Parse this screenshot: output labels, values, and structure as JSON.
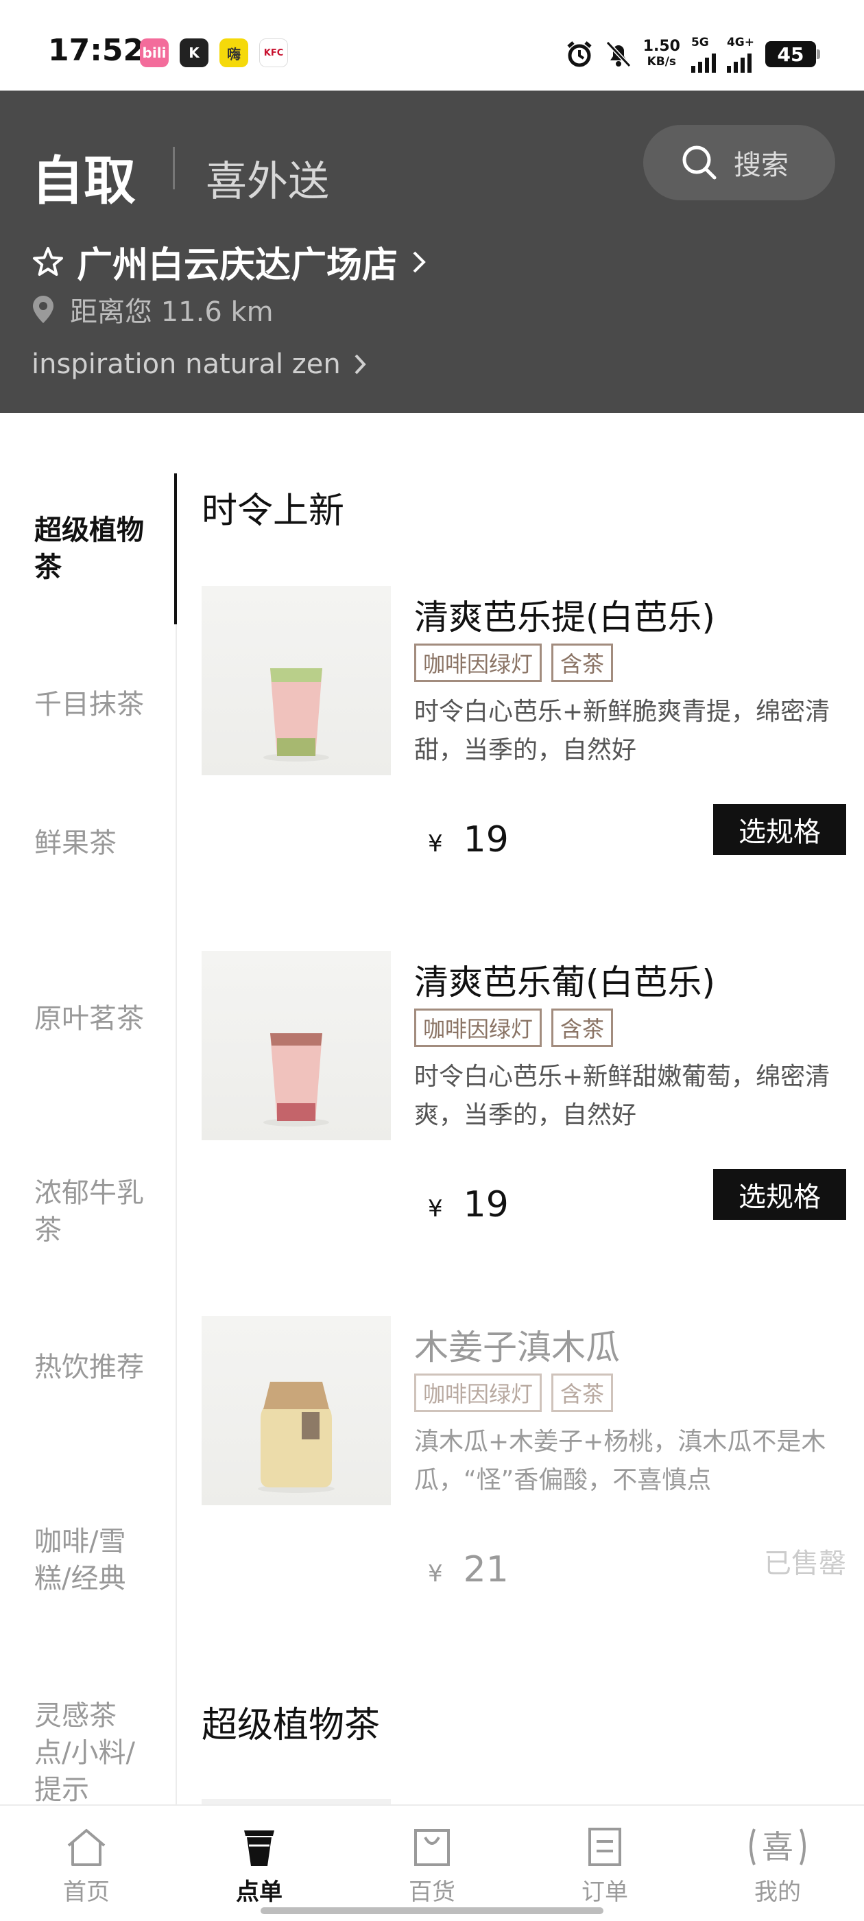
{
  "status_bar": {
    "time": "17:52",
    "app_icons": [
      {
        "name": "bilibili-app-icon",
        "text": "bili",
        "color": "#f36c9b"
      },
      {
        "name": "k-app-icon",
        "text": "K",
        "color": "#222222"
      },
      {
        "name": "yellow-app-icon",
        "text": "嗨",
        "color": "#f5d90a"
      },
      {
        "name": "kfc-coffee-app-icon",
        "text": "KFC",
        "color": "#c8102e"
      }
    ],
    "net_speed": "1.50",
    "net_unit": "KB/s",
    "sig1_label": "5G",
    "sig2_label": "4G+",
    "battery": "45"
  },
  "header": {
    "tab_pickup": "自取",
    "tab_delivery": "喜外送",
    "search_label": "搜索",
    "store_name": "广州白云庆达广场店",
    "distance": "距离您 11.6 km",
    "slogan": "inspiration natural zen"
  },
  "sidebar": {
    "items": [
      {
        "label": "超级植物茶",
        "active": true
      },
      {
        "label": "千目抹茶"
      },
      {
        "label": "鲜果茶"
      },
      {
        "label": "原叶茗茶"
      },
      {
        "label": "浓郁牛乳茶"
      },
      {
        "label": "热饮推荐"
      },
      {
        "label": "咖啡/雪糕/经典"
      },
      {
        "label": "灵感茶点/小料/提示"
      }
    ]
  },
  "content": {
    "section1_title": "时令上新",
    "section2_title": "超级植物茶",
    "products": [
      {
        "name": "清爽芭乐提(白芭乐)",
        "tags": [
          "咖啡因绿灯",
          "含茶"
        ],
        "desc": "时令白心芭乐+新鲜脆爽青提，绵密清甜，当季的，自然好",
        "currency": "¥",
        "price": "19",
        "button": "选规格"
      },
      {
        "name": "清爽芭乐葡(白芭乐)",
        "tags": [
          "咖啡因绿灯",
          "含茶"
        ],
        "desc": "时令白心芭乐+新鲜甜嫩葡萄，绵密清爽，当季的，自然好",
        "currency": "¥",
        "price": "19",
        "button": "选规格"
      },
      {
        "name": "木姜子滇木瓜",
        "tags": [
          "咖啡因绿灯",
          "含茶"
        ],
        "desc": "滇木瓜+木姜子+杨桃，滇木瓜不是木瓜，“怪”香偏酸，不喜慎点",
        "currency": "¥",
        "price": "21",
        "status": "已售罄"
      }
    ]
  },
  "bottom_nav": {
    "items": [
      {
        "label": "首页",
        "icon": "home-icon"
      },
      {
        "label": "点单",
        "icon": "cup-icon",
        "active": true
      },
      {
        "label": "百货",
        "icon": "shopping-bag-icon"
      },
      {
        "label": "订单",
        "icon": "order-list-icon"
      },
      {
        "label": "我的",
        "icon": "xi-logo-icon"
      }
    ]
  },
  "colors": {
    "header_bg": "#4a4a4a",
    "tag_border": "#a28c7e",
    "button_bg": "#111111"
  }
}
